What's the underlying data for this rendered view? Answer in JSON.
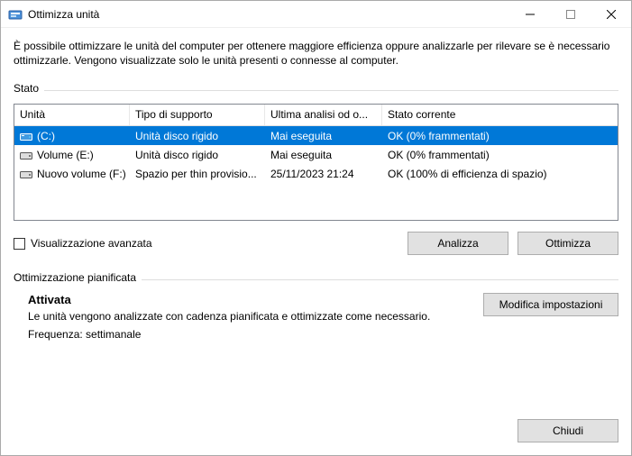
{
  "window": {
    "title": "Ottimizza unità"
  },
  "description": "È possibile ottimizzare le unità del computer per ottenere maggiore efficienza oppure analizzarle per rilevare se è necessario ottimizzarle. Vengono visualizzate solo le unità presenti o connesse al computer.",
  "status_label": "Stato",
  "headers": {
    "unit": "Unità",
    "media": "Tipo di supporto",
    "last": "Ultima analisi od o...",
    "state": "Stato corrente"
  },
  "rows": [
    {
      "name": "(C:)",
      "media": "Unità disco rigido",
      "last": "Mai eseguita",
      "state": "OK (0% frammentati)",
      "selected": true,
      "icon": "os"
    },
    {
      "name": "Volume (E:)",
      "media": "Unità disco rigido",
      "last": "Mai eseguita",
      "state": "OK (0% frammentati)",
      "selected": false,
      "icon": "hdd"
    },
    {
      "name": "Nuovo volume (F:)",
      "media": "Spazio per thin provisio...",
      "last": "25/11/2023 21:24",
      "state": "OK (100% di efficienza di spazio)",
      "selected": false,
      "icon": "hdd"
    }
  ],
  "advanced_view": "Visualizzazione avanzata",
  "buttons": {
    "analyze": "Analizza",
    "optimize": "Ottimizza",
    "change_settings": "Modifica impostazioni",
    "close": "Chiudi"
  },
  "schedule_label": "Ottimizzazione pianificata",
  "schedule": {
    "title": "Attivata",
    "desc": "Le unità vengono analizzate con cadenza pianificata e ottimizzate come necessario.",
    "freq": "Frequenza: settimanale"
  }
}
